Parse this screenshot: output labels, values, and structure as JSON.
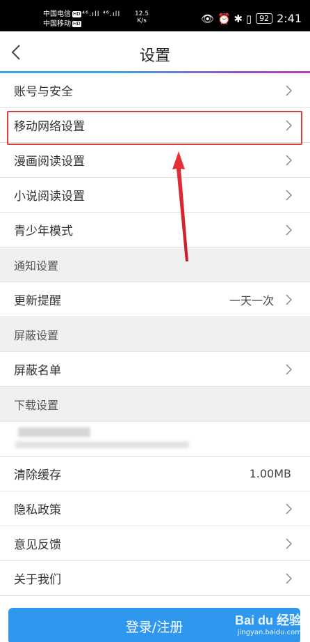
{
  "status_bar": {
    "carrier1": "中国电信",
    "carrier2": "中国移动",
    "hd": "HD",
    "signal": "⁴⁶.ıll ⁴⁶.ıll",
    "speed_value": "12.5",
    "speed_unit": "K/s",
    "icons": "👁 ⏰ ✱ ▯",
    "battery": "92",
    "time": "2:41"
  },
  "header": {
    "title": "设置"
  },
  "items": {
    "account_security": "账号与安全",
    "mobile_network": "移动网络设置",
    "comic_reading": "漫画阅读设置",
    "novel_reading": "小说阅读设置",
    "teen_mode": "青少年模式",
    "notify_section": "通知设置",
    "update_reminder": "更新提醒",
    "update_reminder_value": "一天一次",
    "block_section": "屏蔽设置",
    "block_list": "屏蔽名单",
    "download_section": "下载设置",
    "clear_cache": "清除缓存",
    "clear_cache_value": "1.00MB",
    "privacy_policy": "隐私政策",
    "feedback": "意见反馈",
    "about_us": "关于我们"
  },
  "login_button": "登录/注册",
  "watermark": {
    "brand": "Bai du 经验",
    "url": "jingyan.baidu.com"
  },
  "colors": {
    "accent": "#2f98ee",
    "highlight": "#e03c3c",
    "section_bg": "#f0f0f0"
  }
}
